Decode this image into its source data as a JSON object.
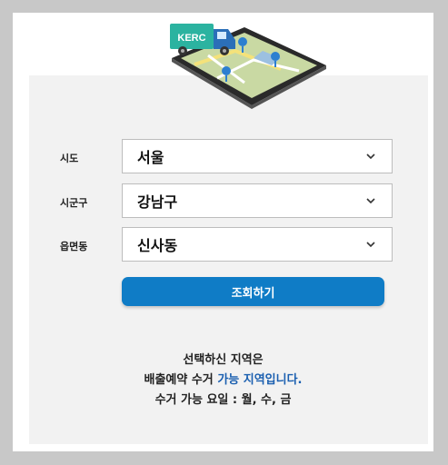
{
  "illustration": {
    "truck_label": "KERC",
    "colors": {
      "truck": "#2bb3a0",
      "tablet": "#2a2a2a",
      "pin": "#2c7fd0"
    }
  },
  "form": {
    "sido": {
      "label": "시도",
      "value": "서울"
    },
    "sigungu": {
      "label": "시군구",
      "value": "강남구"
    },
    "eupmyeondong": {
      "label": "읍면동",
      "value": "신사동"
    },
    "search_label": "조회하기"
  },
  "result": {
    "line1": "선택하신 지역은",
    "line2_prefix": "배출예약 수거",
    "line2_highlight": "가능 지역입니다.",
    "line3": "수거 가능 요일 : 월, 수, 금"
  },
  "colors": {
    "accent": "#0f7cc6",
    "highlight": "#1a5fb0"
  }
}
